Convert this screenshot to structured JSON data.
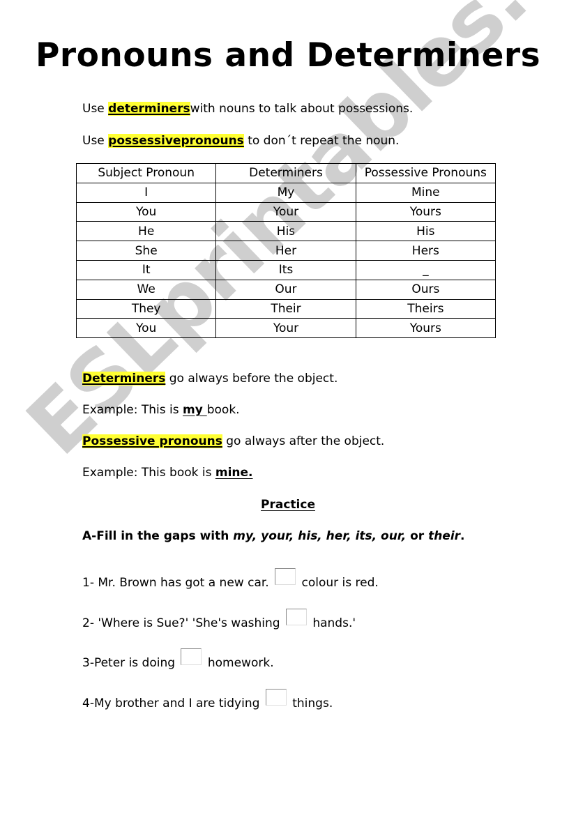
{
  "title": "Pronouns and Determiners",
  "intro": [
    {
      "prefix": "Use ",
      "highlight": "determiners",
      "suffix": "with nouns to talk about possessions."
    },
    {
      "prefix": "Use ",
      "highlight": "possessivepronouns",
      "suffix": " to don´t repeat the noun."
    }
  ],
  "table": {
    "headers": [
      "Subject Pronoun",
      "Determiners",
      "Possessive Pronouns"
    ],
    "rows": [
      [
        "I",
        "My",
        "Mine"
      ],
      [
        "You",
        "Your",
        "Yours"
      ],
      [
        "He",
        "His",
        "His"
      ],
      [
        "She",
        "Her",
        "Hers"
      ],
      [
        "It",
        "Its",
        "_"
      ],
      [
        "We",
        "Our",
        "Ours"
      ],
      [
        "They",
        "Their",
        "Theirs"
      ],
      [
        "You",
        "Your",
        "Yours"
      ]
    ]
  },
  "rules": {
    "determiners": {
      "highlight": "Determiners",
      "text": " go always before the object."
    },
    "example1": {
      "prefix": "Example: This is ",
      "bold": "my ",
      "suffix": "book."
    },
    "possessives": {
      "highlight": "Possessive pronouns",
      "text": " go always after the object."
    },
    "example2": {
      "prefix": "Example: This book is ",
      "bold": "mine."
    }
  },
  "practice": {
    "heading": "Practice",
    "instruction": {
      "prefix": "A-Fill in the gaps with ",
      "words": [
        "my",
        "your",
        "his",
        "her",
        "its",
        "our"
      ],
      "connector": " or ",
      "last": "their",
      "end": "."
    },
    "items": [
      {
        "before": "1- Mr. Brown has got a new car.",
        "after": "colour is red.",
        "answer": ""
      },
      {
        "before": "2- 'Where is Sue?' 'She's washing",
        "after": "hands.'",
        "answer": ""
      },
      {
        "before": "3-Peter is doing",
        "after": "homework.",
        "answer": ""
      },
      {
        "before": "4-My brother and I are tidying",
        "after": "things.",
        "answer": ""
      }
    ]
  },
  "watermark": "ESLprintables.com",
  "colors": {
    "highlight": "#ffff33",
    "text": "#000000",
    "watermark": "#a0a0a0"
  }
}
